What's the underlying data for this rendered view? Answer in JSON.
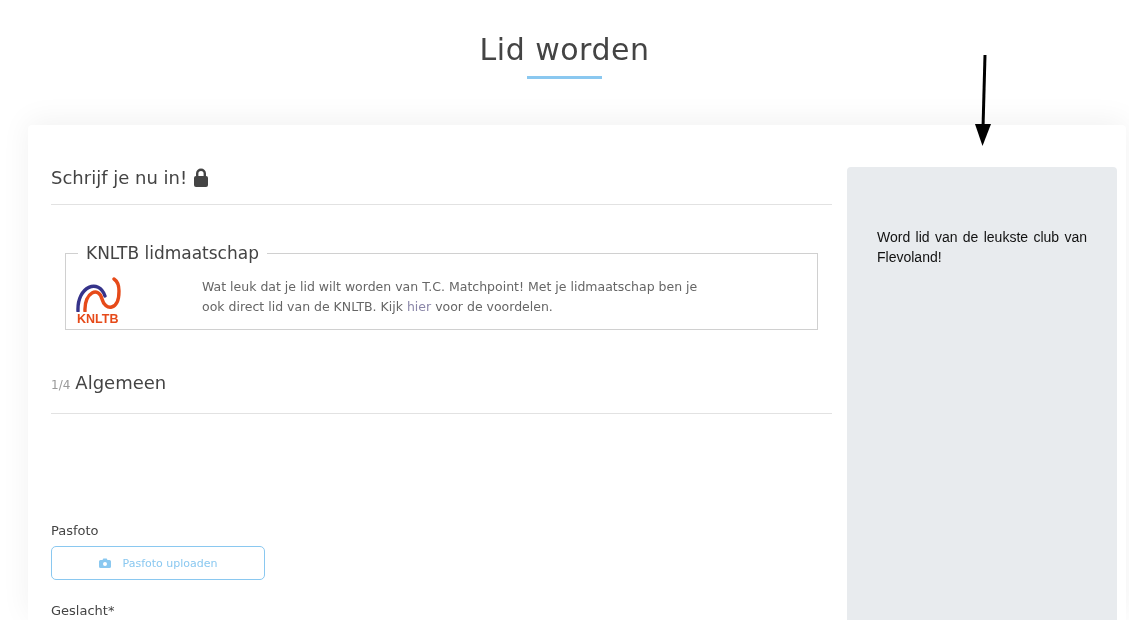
{
  "page": {
    "title": "Lid worden"
  },
  "form": {
    "heading": "Schrijf je nu in!",
    "membership": {
      "legend": "KNLTB lidmaatschap",
      "logo_wordmark": "KNLTB",
      "text_before": "Wat leuk dat je lid wilt worden van T.C. Matchpoint! Met je lidmaatschap ben je ook direct lid van de KNLTB. Kijk",
      "link": "hier",
      "text_after": "voor de voordelen."
    },
    "section": {
      "step": "1/4",
      "title": "Algemeen"
    },
    "photo": {
      "label": "Pasfoto",
      "button": "Pasfoto uploaden"
    },
    "gender": {
      "label": "Geslacht*"
    }
  },
  "sidebar": {
    "text": "Word lid van de leukste club van Flevoland!"
  }
}
